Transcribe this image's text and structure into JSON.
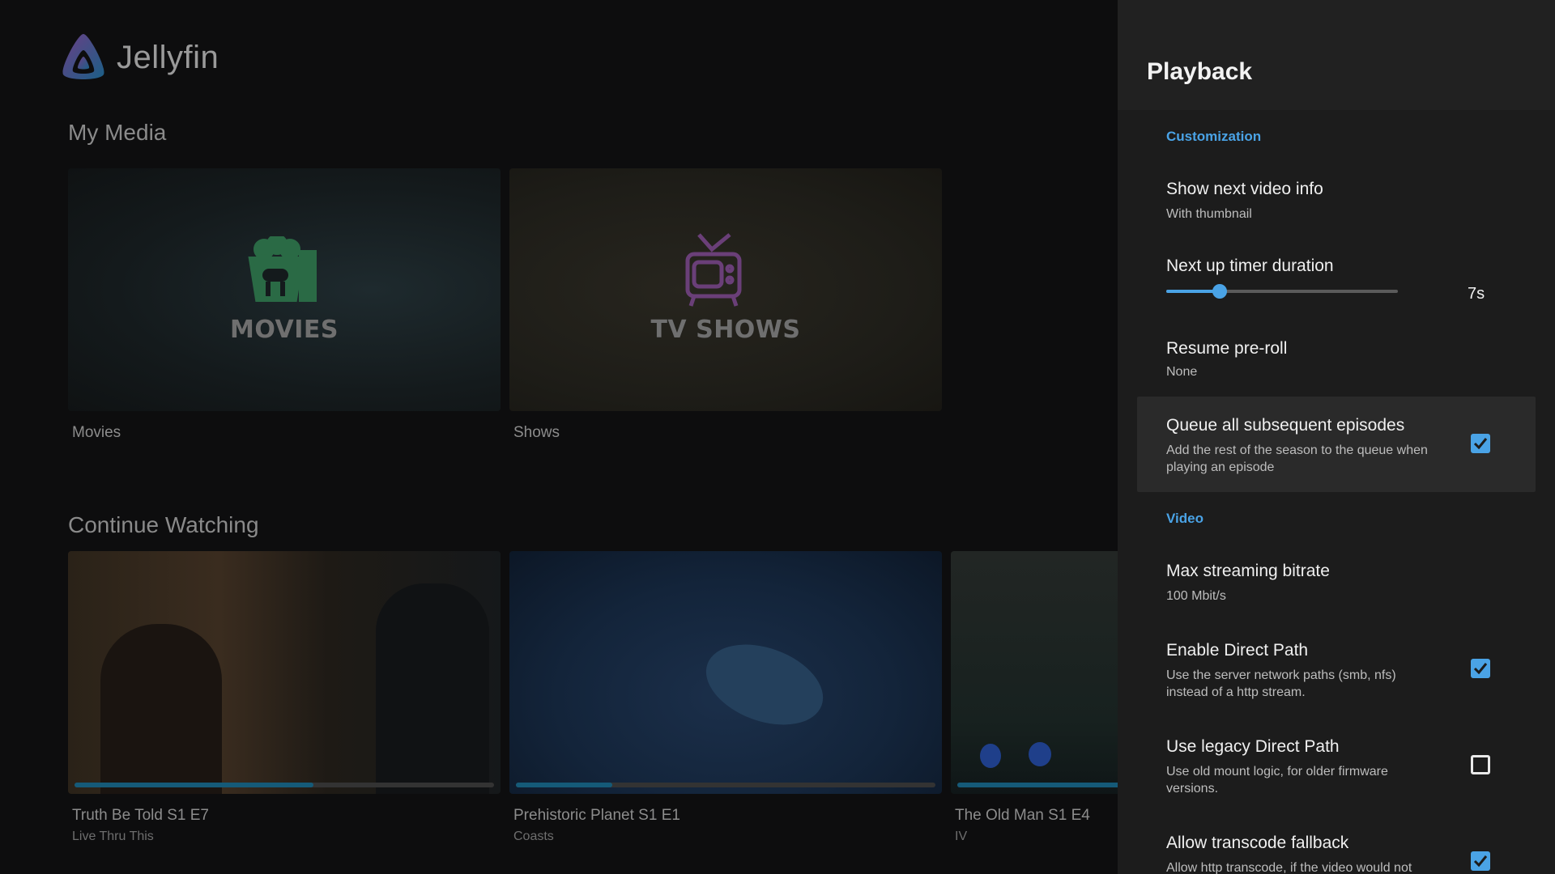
{
  "app": {
    "name": "Jellyfin"
  },
  "home": {
    "my_media_title": "My Media",
    "libraries": [
      {
        "art_text": "MOVIES",
        "label": "Movies",
        "accent": "#2a6a45"
      },
      {
        "art_text": "TV SHOWS",
        "label": "Shows",
        "accent": "#6a3f78"
      }
    ],
    "continue_title": "Continue Watching",
    "continue": [
      {
        "title": "Truth Be Told S1 E7",
        "subtitle": "Live Thru This",
        "progress": 0.57
      },
      {
        "title": "Prehistoric Planet S1 E1",
        "subtitle": "Coasts",
        "progress": 0.23
      },
      {
        "title": "The Old Man S1 E4",
        "subtitle": "IV",
        "progress": 0.8
      }
    ]
  },
  "panel": {
    "title": "Playback",
    "groups": {
      "customization": "Customization",
      "video": "Video"
    },
    "settings": {
      "next_video_info": {
        "title": "Show next video info",
        "value": "With thumbnail"
      },
      "next_up_timer": {
        "title": "Next up timer duration",
        "value": "7s",
        "fraction": 0.23
      },
      "resume_preroll": {
        "title": "Resume pre-roll",
        "value": "None"
      },
      "queue_episodes": {
        "title": "Queue all subsequent episodes",
        "description": "Add the rest of the season to the queue when playing an episode",
        "checked": true
      },
      "max_bitrate": {
        "title": "Max streaming bitrate",
        "value": "100 Mbit/s"
      },
      "direct_path": {
        "title": "Enable Direct Path",
        "description": "Use the server network paths (smb, nfs) instead of a http stream.",
        "checked": true
      },
      "legacy_direct_path": {
        "title": "Use legacy Direct Path",
        "description": "Use old mount logic, for older firmware versions.",
        "checked": false
      },
      "transcode_fallback": {
        "title": "Allow transcode fallback",
        "description": "Allow http transcode, if the video would not",
        "checked": true
      }
    },
    "accent_color": "#4aa3e6"
  }
}
